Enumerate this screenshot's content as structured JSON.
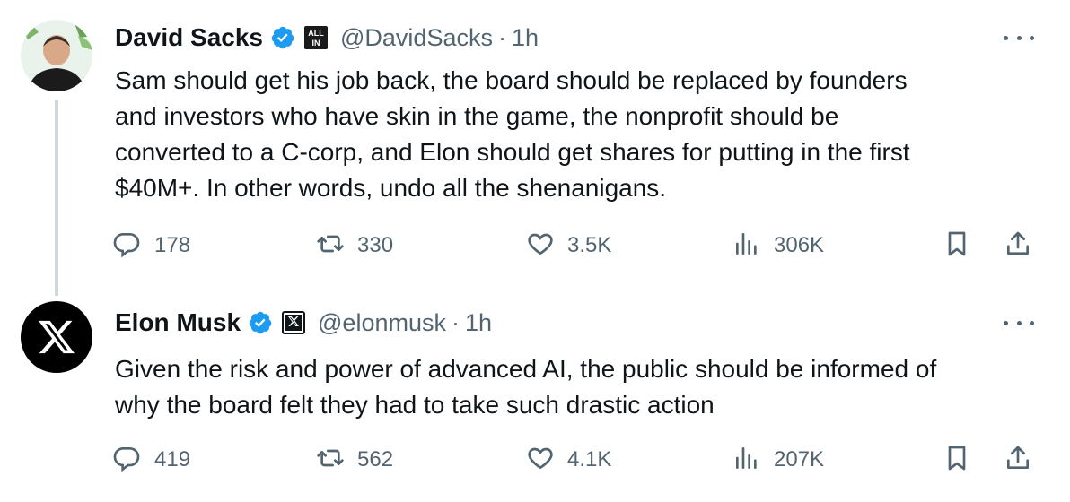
{
  "tweets": [
    {
      "author": {
        "name": "David Sacks",
        "handle": "@DavidSacks",
        "affiliation_badge": "ALL IN"
      },
      "time": "1h",
      "text": "Sam should get his job back, the board should be replaced by founders\nand investors who have skin in the game, the nonprofit should be\nconverted to a C-corp, and Elon should get shares for putting in the first\n$40M+. In other words, undo all the shenanigans.",
      "stats": {
        "replies": "178",
        "reposts": "330",
        "likes": "3.5K",
        "views": "306K"
      }
    },
    {
      "author": {
        "name": "Elon Musk",
        "handle": "@elonmusk",
        "affiliation_badge": "X"
      },
      "time": "1h",
      "text": "Given the risk and power of advanced AI, the public should be informed of\nwhy the board felt they had to take such drastic action",
      "stats": {
        "replies": "419",
        "reposts": "562",
        "likes": "4.1K",
        "views": "207K"
      }
    }
  ],
  "separator": "·",
  "colors": {
    "verified_blue": "#1d9bf0",
    "secondary_text": "#536471",
    "thread_line": "#cfd9de"
  },
  "icons": [
    "reply-icon",
    "repost-icon",
    "like-icon",
    "views-icon",
    "bookmark-icon",
    "share-icon",
    "more-icon",
    "verified-icon"
  ]
}
